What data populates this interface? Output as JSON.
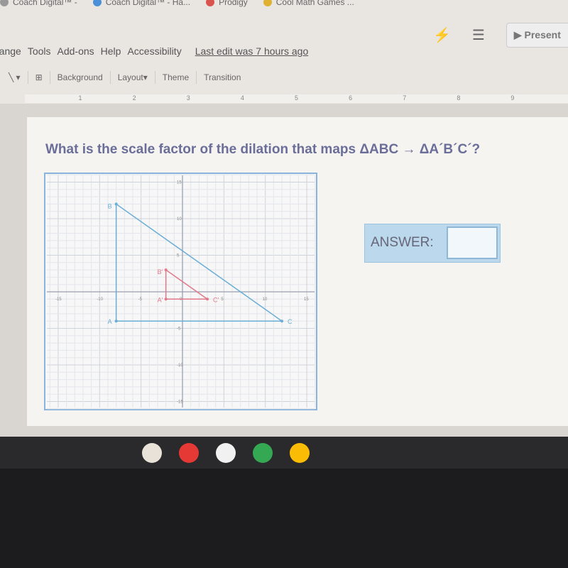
{
  "bookmarks": [
    {
      "label": "Coach Digital™ -",
      "color": "#999"
    },
    {
      "label": "Coach Digital™ - Ha...",
      "color": "#4a90d9"
    },
    {
      "label": "Prodigy",
      "color": "#d9534f"
    },
    {
      "label": "Cool Math Games ...",
      "color": "#e0b030"
    }
  ],
  "menu": {
    "items": [
      "Arrange",
      "Tools",
      "Add-ons",
      "Help",
      "Accessibility"
    ],
    "last_edit": "Last edit was 7 hours ago"
  },
  "header": {
    "present_label": "Present"
  },
  "toolbar": {
    "background": "Background",
    "layout": "Layout",
    "theme": "Theme",
    "transition": "Transition"
  },
  "ruler": [
    "1",
    "2",
    "3",
    "4",
    "5",
    "6",
    "7",
    "8",
    "9"
  ],
  "slide": {
    "question": "What is the scale factor of the dilation that maps ΔABC → ΔA´B´C´?",
    "answer_label": "ANSWER:",
    "answer_value": ""
  },
  "chart_data": {
    "type": "scatter",
    "xlim": [
      -15,
      15
    ],
    "ylim": [
      -15,
      15
    ],
    "grid": true,
    "x_ticks": [
      "-15",
      "-10",
      "-5",
      "0",
      "5",
      "10",
      "15"
    ],
    "y_ticks": [
      "15",
      "10",
      "5",
      "-5",
      "-10",
      "-15"
    ],
    "triangles": [
      {
        "name": "ABC",
        "color": "#6aaed6",
        "points": [
          {
            "label": "A",
            "x": -8,
            "y": -4
          },
          {
            "label": "B",
            "x": -8,
            "y": 12
          },
          {
            "label": "C",
            "x": 12,
            "y": -4
          }
        ]
      },
      {
        "name": "A'B'C'",
        "color": "#e07a8a",
        "points": [
          {
            "label": "A'",
            "x": -2,
            "y": -1
          },
          {
            "label": "B'",
            "x": -2,
            "y": 3
          },
          {
            "label": "C'",
            "x": 3,
            "y": -1
          }
        ]
      }
    ]
  },
  "shelf": {
    "apps": [
      {
        "name": "canvas",
        "color": "#e8e2d8"
      },
      {
        "name": "youtube",
        "color": "#e53935"
      },
      {
        "name": "gmail",
        "color": "#f1f1f1"
      },
      {
        "name": "drive",
        "color": "#34a853"
      },
      {
        "name": "chrome",
        "color": "#fbbc05"
      }
    ]
  }
}
